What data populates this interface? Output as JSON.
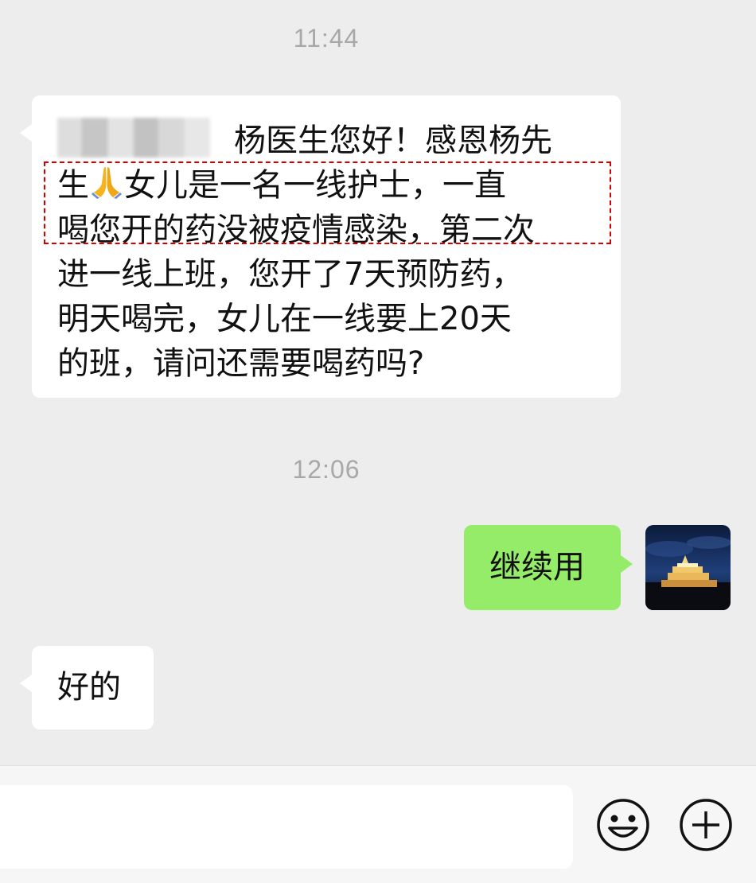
{
  "timestamps": [
    "11:44",
    "12:06"
  ],
  "messages": {
    "incoming_1": {
      "line1_rest": "杨医生您好！感恩杨先",
      "line2_before_emoji": "生",
      "line2_after_emoji": "女儿是一名一线护士，一直",
      "line3": "喝您开的药没被疫情感染，第二次",
      "line4": "进一线上班，您开了7天预防药，",
      "line5": "明天喝完，女儿在一线要上20天",
      "line6": "的班，请问还需要喝药吗?"
    },
    "outgoing_1": "继续用",
    "incoming_2": "好的"
  },
  "colors": {
    "background": "#ededed",
    "incoming_bubble": "#ffffff",
    "outgoing_bubble": "#95ec69",
    "highlight_border": "#d40000",
    "timestamp": "#a8a8a8"
  },
  "icons": {
    "emoji_reaction": "folded-hands-icon",
    "input_emoji": "smiley-face-icon",
    "input_more": "plus-circle-icon"
  }
}
